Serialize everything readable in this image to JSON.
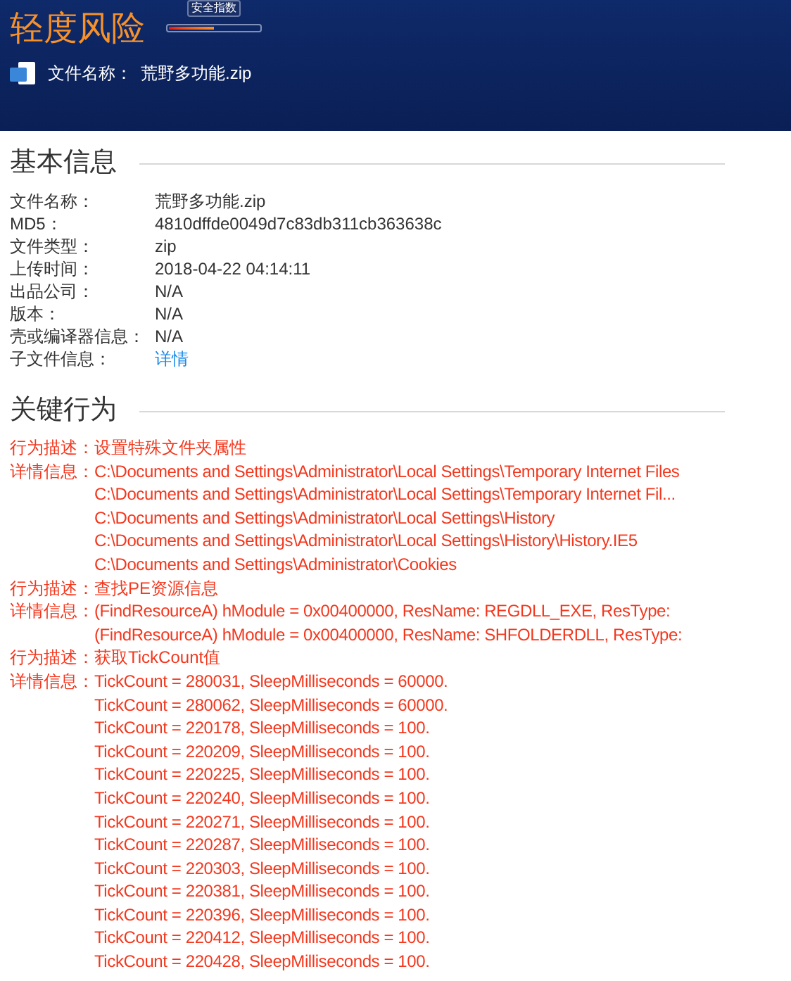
{
  "header": {
    "risk_title": "轻度风险",
    "gauge": {
      "tooltip": "安全指数",
      "level": 0.5
    },
    "file_label": "文件名称：",
    "file_name": "荒野多功能.zip"
  },
  "basic_info": {
    "heading": "基本信息",
    "rows": [
      {
        "label": "文件名称：",
        "value": "荒野多功能.zip",
        "kind": "text"
      },
      {
        "label": "MD5：",
        "value": "4810dffde0049d7c83db311cb363638c",
        "kind": "text"
      },
      {
        "label": "文件类型：",
        "value": "zip",
        "kind": "text"
      },
      {
        "label": "上传时间：",
        "value": "2018-04-22 04:14:11",
        "kind": "text"
      },
      {
        "label": "出品公司：",
        "value": "N/A",
        "kind": "text"
      },
      {
        "label": "版本：",
        "value": "N/A",
        "kind": "text"
      },
      {
        "label": "壳或编译器信息：",
        "value": "N/A",
        "kind": "text"
      },
      {
        "label": "子文件信息：",
        "value": "详情",
        "kind": "link"
      }
    ]
  },
  "key_behaviors": {
    "heading": "关键行为",
    "items": [
      {
        "desc_label": "行为描述：",
        "description": "设置特殊文件夹属性",
        "detail_label": "详情信息：",
        "details": [
          "C:\\Documents and Settings\\Administrator\\Local Settings\\Temporary Internet Files",
          "C:\\Documents and Settings\\Administrator\\Local Settings\\Temporary Internet Fil...",
          "C:\\Documents and Settings\\Administrator\\Local Settings\\History",
          "C:\\Documents and Settings\\Administrator\\Local Settings\\History\\History.IE5",
          "C:\\Documents and Settings\\Administrator\\Cookies"
        ]
      },
      {
        "desc_label": "行为描述：",
        "description": "查找PE资源信息",
        "detail_label": "详情信息：",
        "details": [
          "(FindResourceA) hModule = 0x00400000, ResName: REGDLL_EXE, ResType:",
          "(FindResourceA) hModule = 0x00400000, ResName: SHFOLDERDLL, ResType:"
        ]
      },
      {
        "desc_label": "行为描述：",
        "description": "获取TickCount值",
        "detail_label": "详情信息：",
        "details": [
          "TickCount = 280031, SleepMilliseconds = 60000.",
          "TickCount = 280062, SleepMilliseconds = 60000.",
          "TickCount = 220178, SleepMilliseconds = 100.",
          "TickCount = 220209, SleepMilliseconds = 100.",
          "TickCount = 220225, SleepMilliseconds = 100.",
          "TickCount = 220240, SleepMilliseconds = 100.",
          "TickCount = 220271, SleepMilliseconds = 100.",
          "TickCount = 220287, SleepMilliseconds = 100.",
          "TickCount = 220303, SleepMilliseconds = 100.",
          "TickCount = 220381, SleepMilliseconds = 100.",
          "TickCount = 220396, SleepMilliseconds = 100.",
          "TickCount = 220412, SleepMilliseconds = 100.",
          "TickCount = 220428, SleepMilliseconds = 100."
        ]
      }
    ]
  }
}
